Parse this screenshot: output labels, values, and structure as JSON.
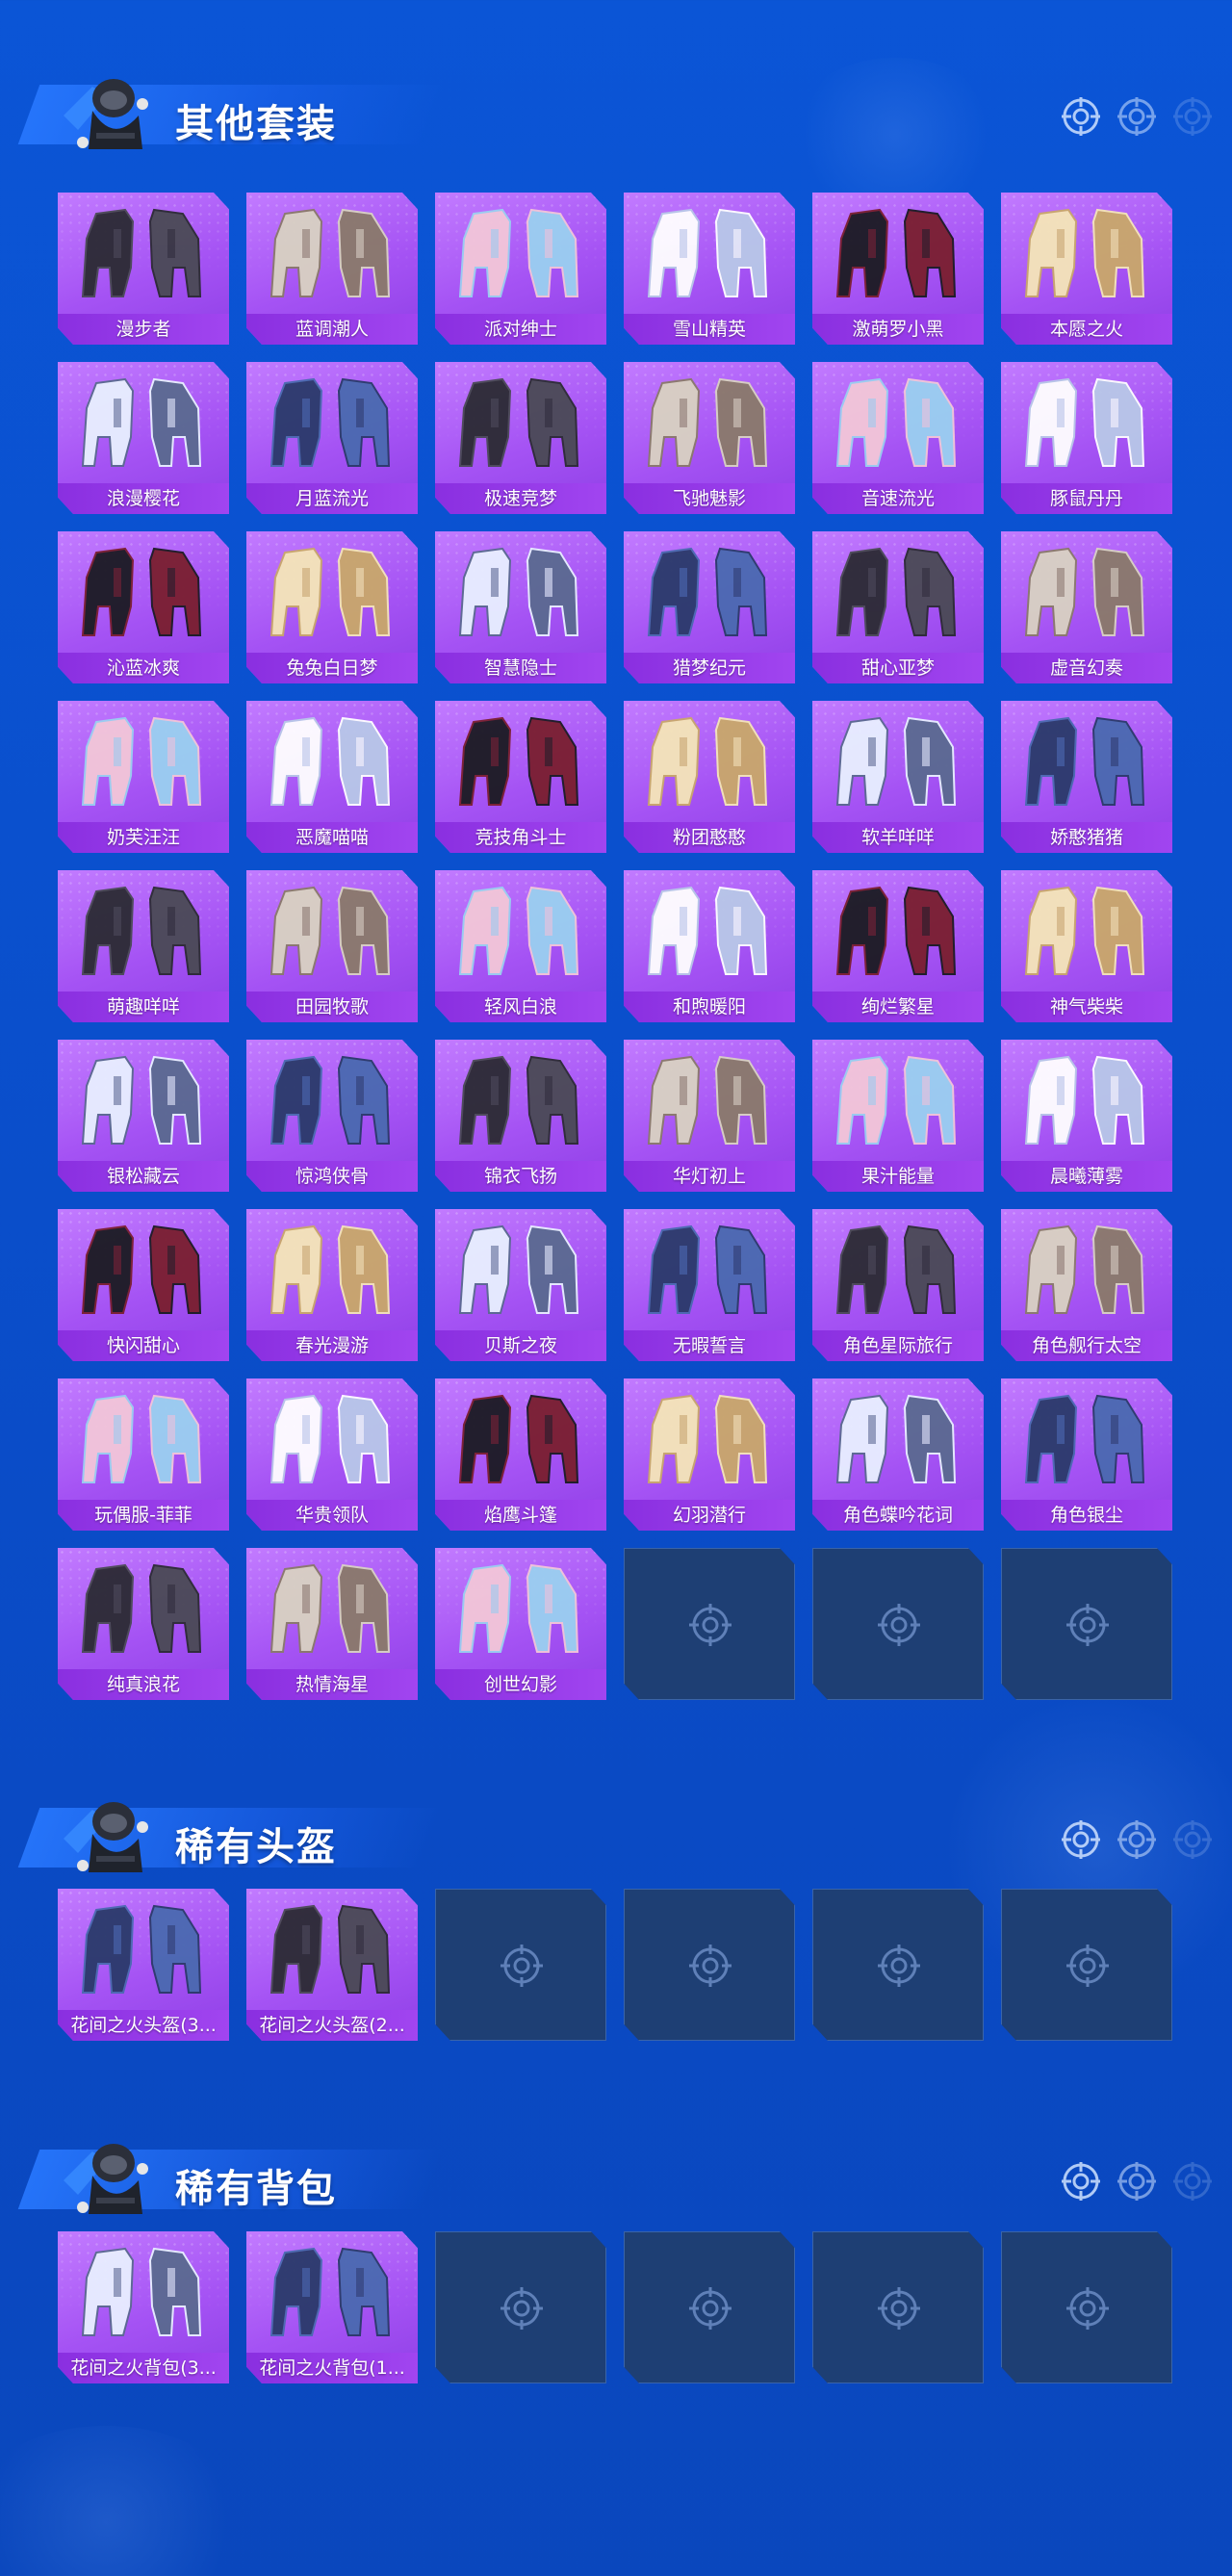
{
  "sections": [
    {
      "title": "其他套装",
      "items": [
        "漫步者",
        "蓝调潮人",
        "派对绅士",
        "雪山精英",
        "激萌罗小黑",
        "本愿之火",
        "浪漫樱花",
        "月蓝流光",
        "极速竞梦",
        "飞驰魅影",
        "音速流光",
        "豚鼠丹丹",
        "沁蓝冰爽",
        "兔兔白日梦",
        "智慧隐士",
        "猎梦纪元",
        "甜心亚梦",
        "虚音幻奏",
        "奶芙汪汪",
        "恶魔喵喵",
        "竞技角斗士",
        "粉团憨憨",
        "软羊咩咩",
        "娇憨猪猪",
        "萌趣咩咩",
        "田园牧歌",
        "轻风白浪",
        "和煦暖阳",
        "绚烂繁星",
        "神气柴柴",
        "银松藏云",
        "惊鸿侠骨",
        "锦衣飞扬",
        "华灯初上",
        "果汁能量",
        "晨曦薄雾",
        "快闪甜心",
        "春光漫游",
        "贝斯之夜",
        "无暇誓言",
        "角色星际旅行",
        "角色舰行太空",
        "玩偶服-菲菲",
        "华贵领队",
        "焰鹰斗篷",
        "幻羽潜行",
        "角色蝶吟花词",
        "角色银尘",
        "纯真浪花",
        "热情海星",
        "创世幻影"
      ],
      "empty_slots": 3
    },
    {
      "title": "稀有头盔",
      "items": [
        "花间之火头盔(3...",
        "花间之火头盔(2..."
      ],
      "empty_slots": 4
    },
    {
      "title": "稀有背包",
      "items": [
        "花间之火背包(3...",
        "花间之火背包(1..."
      ],
      "empty_slots": 4
    }
  ],
  "colors": {
    "background": "#0b55d6",
    "card_fill": "#a553f4",
    "card_label": "#8a2fe0",
    "empty_card": "#1e3f74"
  }
}
